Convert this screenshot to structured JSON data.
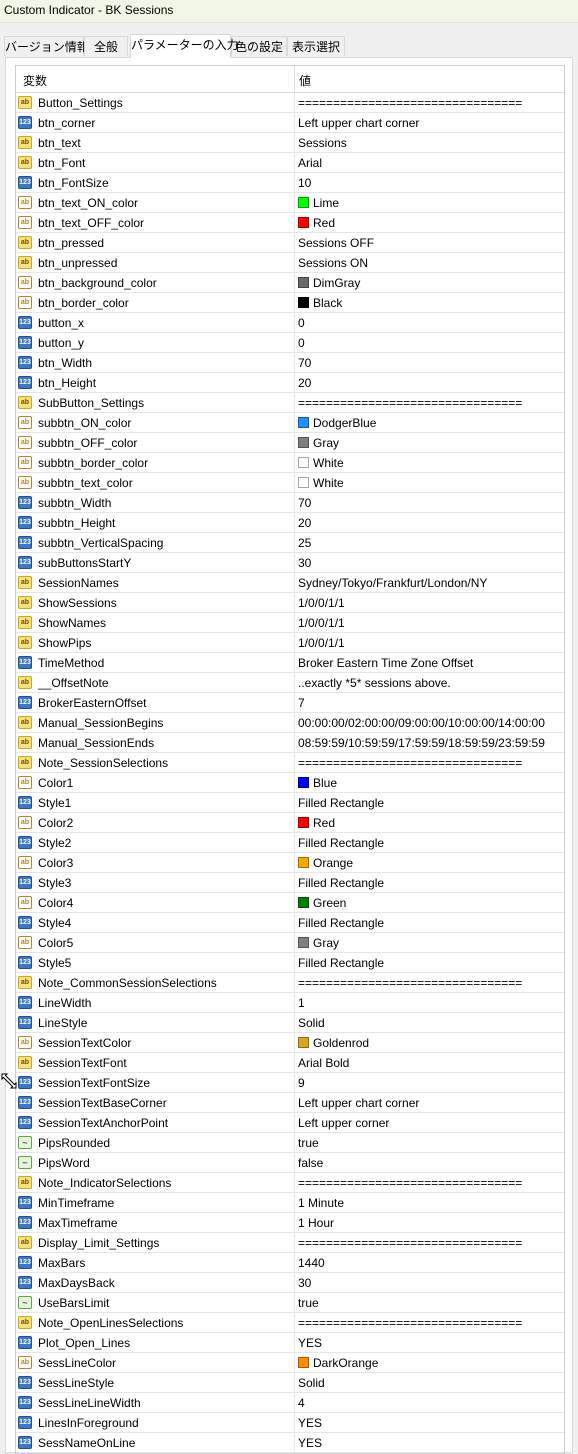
{
  "window": {
    "title": "Custom Indicator - BK Sessions"
  },
  "tabs": [
    {
      "label": "バージョン情報",
      "active": false
    },
    {
      "label": "全般",
      "active": false
    },
    {
      "label": "パラメーターの入力",
      "active": true
    },
    {
      "label": "色の設定",
      "active": false
    },
    {
      "label": "表示選択",
      "active": false
    }
  ],
  "grid": {
    "col_variable": "変数",
    "col_value": "値",
    "rows": [
      {
        "type": "string",
        "name": "Button_Settings",
        "value": "================================"
      },
      {
        "type": "int",
        "name": "btn_corner",
        "value": "Left upper chart corner"
      },
      {
        "type": "string",
        "name": "btn_text",
        "value": "Sessions"
      },
      {
        "type": "string",
        "name": "btn_Font",
        "value": "Arial"
      },
      {
        "type": "int",
        "name": "btn_FontSize",
        "value": "10"
      },
      {
        "type": "color",
        "name": "btn_text_ON_color",
        "value": "Lime",
        "swatch": "#00ff00"
      },
      {
        "type": "color",
        "name": "btn_text_OFF_color",
        "value": "Red",
        "swatch": "#ff0000"
      },
      {
        "type": "string",
        "name": "btn_pressed",
        "value": "Sessions OFF"
      },
      {
        "type": "string",
        "name": "btn_unpressed",
        "value": "Sessions ON"
      },
      {
        "type": "color",
        "name": "btn_background_color",
        "value": "DimGray",
        "swatch": "#696969"
      },
      {
        "type": "color",
        "name": "btn_border_color",
        "value": "Black",
        "swatch": "#000000"
      },
      {
        "type": "int",
        "name": "button_x",
        "value": "0"
      },
      {
        "type": "int",
        "name": "button_y",
        "value": "0"
      },
      {
        "type": "int",
        "name": "btn_Width",
        "value": "70"
      },
      {
        "type": "int",
        "name": "btn_Height",
        "value": "20"
      },
      {
        "type": "string",
        "name": "SubButton_Settings",
        "value": "================================"
      },
      {
        "type": "color",
        "name": "subbtn_ON_color",
        "value": "DodgerBlue",
        "swatch": "#1e90ff"
      },
      {
        "type": "color",
        "name": "subbtn_OFF_color",
        "value": "Gray",
        "swatch": "#808080"
      },
      {
        "type": "color",
        "name": "subbtn_border_color",
        "value": "White",
        "swatch": "#ffffff"
      },
      {
        "type": "color",
        "name": "subbtn_text_color",
        "value": "White",
        "swatch": "#ffffff"
      },
      {
        "type": "int",
        "name": "subbtn_Width",
        "value": "70"
      },
      {
        "type": "int",
        "name": "subbtn_Height",
        "value": "20"
      },
      {
        "type": "int",
        "name": "subbtn_VerticalSpacing",
        "value": "25"
      },
      {
        "type": "int",
        "name": "subButtonsStartY",
        "value": "30"
      },
      {
        "type": "string",
        "name": "SessionNames",
        "value": "Sydney/Tokyo/Frankfurt/London/NY"
      },
      {
        "type": "string",
        "name": "ShowSessions",
        "value": "1/0/0/1/1"
      },
      {
        "type": "string",
        "name": "ShowNames",
        "value": "1/0/0/1/1"
      },
      {
        "type": "string",
        "name": "ShowPips",
        "value": "1/0/0/1/1"
      },
      {
        "type": "int",
        "name": "TimeMethod",
        "value": "Broker Eastern Time Zone Offset"
      },
      {
        "type": "string",
        "name": "__OffsetNote",
        "value": "..exactly *5* sessions above."
      },
      {
        "type": "int",
        "name": "BrokerEasternOffset",
        "value": "7"
      },
      {
        "type": "string",
        "name": "Manual_SessionBegins",
        "value": "00:00:00/02:00:00/09:00:00/10:00:00/14:00:00"
      },
      {
        "type": "string",
        "name": "Manual_SessionEnds",
        "value": "08:59:59/10:59:59/17:59:59/18:59:59/23:59:59"
      },
      {
        "type": "string",
        "name": "Note_SessionSelections",
        "value": "================================"
      },
      {
        "type": "color",
        "name": "Color1",
        "value": "Blue",
        "swatch": "#0000ff"
      },
      {
        "type": "int",
        "name": "Style1",
        "value": "Filled Rectangle"
      },
      {
        "type": "color",
        "name": "Color2",
        "value": "Red",
        "swatch": "#ff0000"
      },
      {
        "type": "int",
        "name": "Style2",
        "value": "Filled Rectangle"
      },
      {
        "type": "color",
        "name": "Color3",
        "value": "Orange",
        "swatch": "#ffa500"
      },
      {
        "type": "int",
        "name": "Style3",
        "value": "Filled Rectangle"
      },
      {
        "type": "color",
        "name": "Color4",
        "value": "Green",
        "swatch": "#008000"
      },
      {
        "type": "int",
        "name": "Style4",
        "value": "Filled Rectangle"
      },
      {
        "type": "color",
        "name": "Color5",
        "value": "Gray",
        "swatch": "#808080"
      },
      {
        "type": "int",
        "name": "Style5",
        "value": "Filled Rectangle"
      },
      {
        "type": "string",
        "name": "Note_CommonSessionSelections",
        "value": "================================"
      },
      {
        "type": "int",
        "name": "LineWidth",
        "value": "1"
      },
      {
        "type": "int",
        "name": "LineStyle",
        "value": "Solid"
      },
      {
        "type": "color",
        "name": "SessionTextColor",
        "value": "Goldenrod",
        "swatch": "#daa520"
      },
      {
        "type": "string",
        "name": "SessionTextFont",
        "value": "Arial Bold"
      },
      {
        "type": "int",
        "name": "SessionTextFontSize",
        "value": "9"
      },
      {
        "type": "int",
        "name": "SessionTextBaseCorner",
        "value": "Left upper chart corner"
      },
      {
        "type": "int",
        "name": "SessionTextAnchorPoint",
        "value": "Left upper corner"
      },
      {
        "type": "bool",
        "name": "PipsRounded",
        "value": "true"
      },
      {
        "type": "bool",
        "name": "PipsWord",
        "value": "false"
      },
      {
        "type": "string",
        "name": "Note_IndicatorSelections",
        "value": "================================"
      },
      {
        "type": "int",
        "name": "MinTimeframe",
        "value": "1 Minute"
      },
      {
        "type": "int",
        "name": "MaxTimeframe",
        "value": "1 Hour"
      },
      {
        "type": "string",
        "name": "Display_Limit_Settings",
        "value": "================================"
      },
      {
        "type": "int",
        "name": "MaxBars",
        "value": "1440"
      },
      {
        "type": "int",
        "name": "MaxDaysBack",
        "value": "30"
      },
      {
        "type": "bool",
        "name": "UseBarsLimit",
        "value": "true"
      },
      {
        "type": "string",
        "name": "Note_OpenLinesSelections",
        "value": "================================"
      },
      {
        "type": "int",
        "name": "Plot_Open_Lines",
        "value": "YES"
      },
      {
        "type": "color",
        "name": "SessLineColor",
        "value": "DarkOrange",
        "swatch": "#ff8c00"
      },
      {
        "type": "int",
        "name": "SessLineStyle",
        "value": "Solid"
      },
      {
        "type": "int",
        "name": "SessLineLineWidth",
        "value": "4"
      },
      {
        "type": "int",
        "name": "LinesInForeground",
        "value": "YES"
      },
      {
        "type": "int",
        "name": "SessNameOnLine",
        "value": "YES"
      }
    ]
  }
}
